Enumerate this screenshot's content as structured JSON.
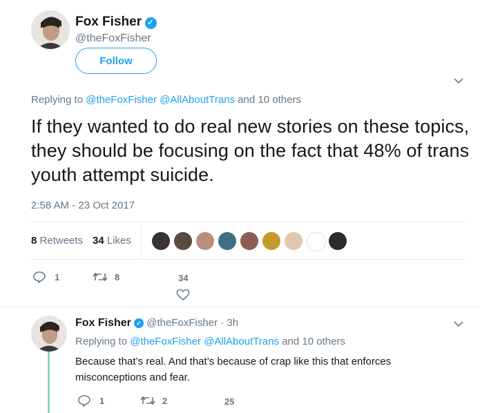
{
  "main_tweet": {
    "author_name": "Fox Fisher",
    "author_handle": "@theFoxFisher",
    "follow_label": "Follow",
    "replying_prefix": "Replying to",
    "replying_to": [
      "@theFoxFisher",
      "@AllAboutTrans"
    ],
    "replying_others": "and 10 others",
    "text": "If they wanted to do real new stories on these topics, they should be focusing on the fact that 48% of trans youth attempt suicide.",
    "timestamp": "2:58 AM - 23 Oct 2017",
    "retweets_count": "8",
    "retweets_label": "Retweets",
    "likes_count": "34",
    "likes_label": "Likes",
    "reply_count": "1",
    "retweet_action_count": "8",
    "like_action_count": "34"
  },
  "reply_tweet": {
    "author_name": "Fox Fisher",
    "author_handle": "@theFoxFisher",
    "time_sep": "·",
    "time": "3h",
    "replying_prefix": "Replying to",
    "replying_to": [
      "@theFoxFisher",
      "@AllAboutTrans"
    ],
    "replying_others": "and 10 others",
    "text": "Because that’s real. And that’s because of crap like this that enforces misconceptions and fear.",
    "reply_count": "1",
    "retweet_count": "2",
    "like_count": "25"
  },
  "liker_avatars": [
    "#3a3330",
    "#5b4a3f",
    "#b98f80",
    "#3f6f86",
    "#8b5e52",
    "#c59a2a",
    "#e3c6ae",
    "#ffffff",
    "#2b2b2b"
  ],
  "colors": {
    "accent": "#1da1f2",
    "muted": "#657786",
    "thread_line": "#8fd3cb"
  }
}
